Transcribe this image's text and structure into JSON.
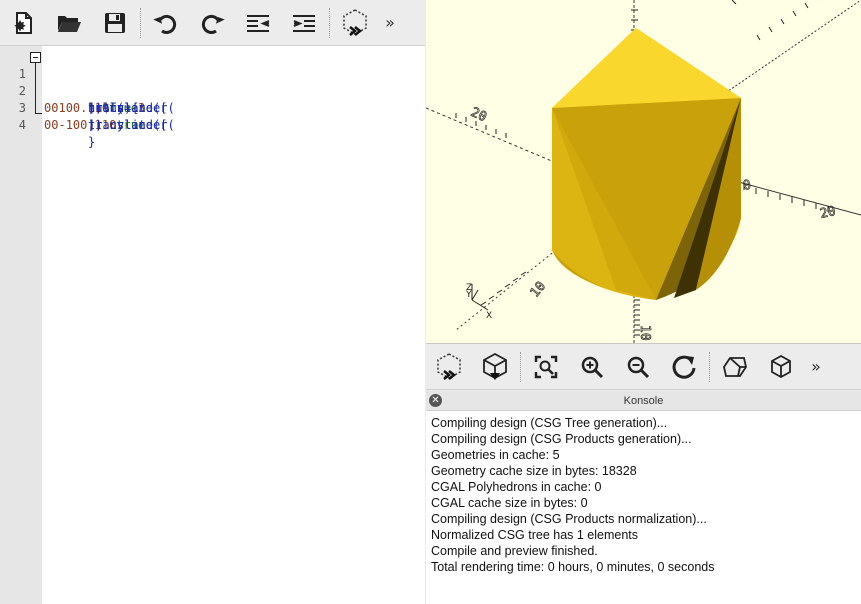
{
  "editor": {
    "toolbar": {
      "buttons": [
        "new-file-icon",
        "open-file-icon",
        "save-file-icon",
        "undo-icon",
        "redo-icon",
        "unindent-icon",
        "indent-icon",
        "preview-icon"
      ],
      "more": "»"
    },
    "lines": [
      {
        "number": "1",
        "parts": [
          {
            "t": "hull(){",
            "c": "code"
          }
        ]
      },
      {
        "number": "2",
        "parts": [
          {
            "t": "translate([",
            "c": "code"
          },
          {
            "t": "0",
            "c": "num"
          },
          {
            "t": " ,",
            "c": "code"
          },
          {
            "t": "0",
            "c": "num"
          },
          {
            "t": ", ",
            "c": "code"
          },
          {
            "t": "10",
            "c": "num"
          },
          {
            "t": "]) cylinder(",
            "c": "code"
          },
          {
            "t": "0.1",
            "c": "num"
          },
          {
            "t": ", ",
            "c": "code"
          },
          {
            "t": "10",
            "c": "num"
          },
          {
            "t": ", ",
            "c": "code"
          },
          {
            "t": "true",
            "c": "kw"
          },
          {
            "t": ", $fn=",
            "c": "code"
          },
          {
            "t": "3",
            "c": "num"
          },
          {
            "t": ");",
            "c": "code"
          }
        ]
      },
      {
        "number": "3",
        "parts": [
          {
            "t": "translate([",
            "c": "code"
          },
          {
            "t": "0",
            "c": "num"
          },
          {
            "t": " ,",
            "c": "code"
          },
          {
            "t": "0",
            "c": "num"
          },
          {
            "t": ", ",
            "c": "code"
          },
          {
            "t": "-10",
            "c": "num"
          },
          {
            "t": "]) cylinder(",
            "c": "code"
          },
          {
            "t": "0.1",
            "c": "num"
          },
          {
            "t": ", ",
            "c": "code"
          },
          {
            "t": "10",
            "c": "num"
          },
          {
            "t": ", ",
            "c": "code"
          },
          {
            "t": "true",
            "c": "kw"
          },
          {
            "t": ");",
            "c": "code"
          }
        ]
      },
      {
        "number": "4",
        "parts": [
          {
            "t": "}",
            "c": "code"
          }
        ]
      }
    ]
  },
  "viewport": {
    "background": "#ffffe5",
    "model_color": "#f9d72c",
    "axis_labels": {
      "y": "Y",
      "z": "Z",
      "x": "X"
    },
    "tick_labels": {
      "x_pos": "20",
      "x_zero": "0",
      "x_neg": "20",
      "y_neg": "10",
      "z_neg": "10"
    }
  },
  "view_toolbar": {
    "buttons": [
      "preview-icon",
      "render-icon",
      "view-all-icon",
      "zoom-in-icon",
      "zoom-out-icon",
      "reset-view-icon",
      "perspective-icon",
      "orthogonal-icon"
    ],
    "more": "»"
  },
  "console": {
    "title": "Konsole",
    "close": "✕",
    "lines": [
      "Compiling design (CSG Tree generation)...",
      "Compiling design (CSG Products generation)...",
      "Geometries in cache: 5",
      "Geometry cache size in bytes: 18328",
      "CGAL Polyhedrons in cache: 0",
      "CGAL cache size in bytes: 0",
      "Compiling design (CSG Products normalization)...",
      "Normalized CSG tree has 1 elements",
      "Compile and preview finished.",
      "Total rendering time: 0 hours, 0 minutes, 0 seconds"
    ]
  }
}
